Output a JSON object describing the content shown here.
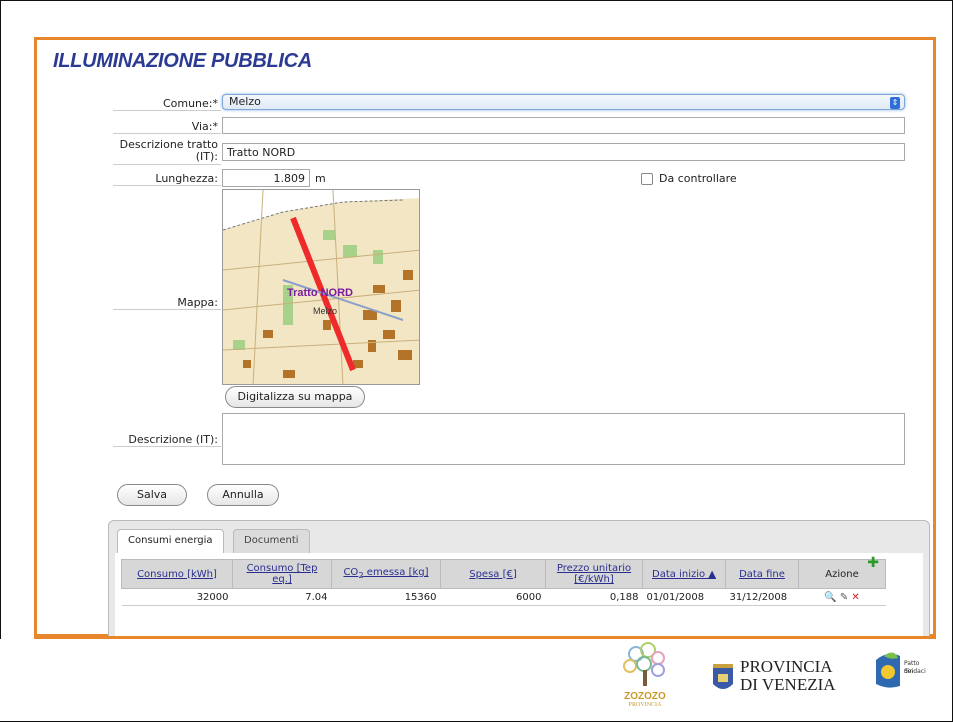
{
  "title": "ILLUMINAZIONE PUBBLICA",
  "form": {
    "comune_label": "Comune:",
    "comune_value": "Melzo",
    "via_label": "Via:",
    "via_value": "",
    "required_mark": "*",
    "descr_tratto_label_1": "Descrizione tratto",
    "descr_tratto_label_2": "(IT):",
    "descr_tratto_value": "Tratto NORD",
    "lunghezza_label": "Lunghezza:",
    "lunghezza_value": "1.809",
    "lunghezza_unit": "m",
    "da_controllare_label": "Da controllare",
    "mappa_label": "Mappa:",
    "map_label_tratto": "Tratto NORD",
    "map_label_town": "Melzo",
    "digitalizza_label": "Digitalizza su mappa",
    "descrizione_label": "Descrizione (IT):",
    "descrizione_value": ""
  },
  "actions": {
    "salva": "Salva",
    "annulla": "Annulla"
  },
  "tabs": [
    {
      "label": "Consumi energia",
      "active": true
    },
    {
      "label": "Documenti",
      "active": false
    }
  ],
  "table": {
    "headers": {
      "consumo_kwh": "Consumo [kWh]",
      "consumo_tep_1": "Consumo [Tep",
      "consumo_tep_2": "eq.]",
      "co2_pre": "CO",
      "co2_sub": "2",
      "co2_post": " emessa [kg]",
      "spesa": "Spesa [€]",
      "prezzo_1": "Prezzo unitario",
      "prezzo_2": "[€/kWh]",
      "data_inizio": "Data inizio ▲",
      "data_fine": "Data fine",
      "azione": "Azione"
    },
    "rows": [
      {
        "consumo_kwh": "32000",
        "consumo_tep": "7.04",
        "co2": "15360",
        "spesa": "6000",
        "prezzo": "0,188",
        "data_inizio": "01/01/2008",
        "data_fine": "31/12/2008"
      }
    ]
  },
  "logos": {
    "zozozo_1": "ZOZOZO",
    "zozozo_2": "PROVINCIA",
    "provincia_1": "PROVINCIA",
    "provincia_2": "DI VENEZIA",
    "patto_1": "Patto dei",
    "patto_2": "Sindaci"
  },
  "colors": {
    "accent": "#e8862c",
    "title": "#2b3a93",
    "select_focus": "#7fa6d6"
  }
}
